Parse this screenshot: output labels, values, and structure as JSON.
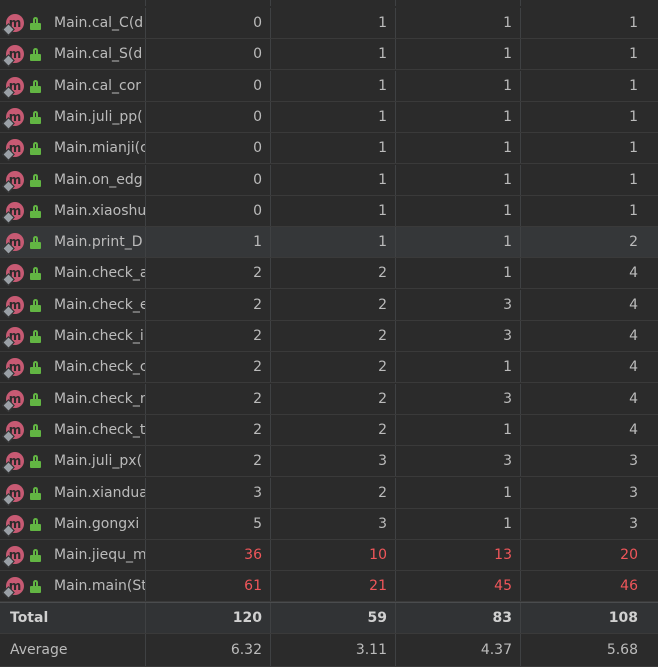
{
  "rows": [
    {
      "name": "Main.cal_C(d",
      "v": [
        "0",
        "1",
        "1",
        "1"
      ],
      "red": [
        false,
        false,
        false,
        false
      ]
    },
    {
      "name": "Main.cal_S(d",
      "v": [
        "0",
        "1",
        "1",
        "1"
      ],
      "red": [
        false,
        false,
        false,
        false
      ]
    },
    {
      "name": "Main.cal_cor",
      "v": [
        "0",
        "1",
        "1",
        "1"
      ],
      "red": [
        false,
        false,
        false,
        false
      ]
    },
    {
      "name": "Main.juli_pp(",
      "v": [
        "0",
        "1",
        "1",
        "1"
      ],
      "red": [
        false,
        false,
        false,
        false
      ]
    },
    {
      "name": "Main.mianji(c",
      "v": [
        "0",
        "1",
        "1",
        "1"
      ],
      "red": [
        false,
        false,
        false,
        false
      ]
    },
    {
      "name": "Main.on_edg",
      "v": [
        "0",
        "1",
        "1",
        "1"
      ],
      "red": [
        false,
        false,
        false,
        false
      ]
    },
    {
      "name": "Main.xiaoshu",
      "v": [
        "0",
        "1",
        "1",
        "1"
      ],
      "red": [
        false,
        false,
        false,
        false
      ]
    },
    {
      "name": "Main.print_D",
      "v": [
        "1",
        "1",
        "1",
        "2"
      ],
      "red": [
        false,
        false,
        false,
        false
      ]
    },
    {
      "name": "Main.check_a",
      "v": [
        "2",
        "2",
        "1",
        "4"
      ],
      "red": [
        false,
        false,
        false,
        false
      ]
    },
    {
      "name": "Main.check_e",
      "v": [
        "2",
        "2",
        "3",
        "4"
      ],
      "red": [
        false,
        false,
        false,
        false
      ]
    },
    {
      "name": "Main.check_i",
      "v": [
        "2",
        "2",
        "3",
        "4"
      ],
      "red": [
        false,
        false,
        false,
        false
      ]
    },
    {
      "name": "Main.check_c",
      "v": [
        "2",
        "2",
        "1",
        "4"
      ],
      "red": [
        false,
        false,
        false,
        false
      ]
    },
    {
      "name": "Main.check_r",
      "v": [
        "2",
        "2",
        "3",
        "4"
      ],
      "red": [
        false,
        false,
        false,
        false
      ]
    },
    {
      "name": "Main.check_t",
      "v": [
        "2",
        "2",
        "1",
        "4"
      ],
      "red": [
        false,
        false,
        false,
        false
      ]
    },
    {
      "name": "Main.juli_px(",
      "v": [
        "2",
        "3",
        "3",
        "3"
      ],
      "red": [
        false,
        false,
        false,
        false
      ]
    },
    {
      "name": "Main.xianduа",
      "v": [
        "3",
        "2",
        "1",
        "3"
      ],
      "red": [
        false,
        false,
        false,
        false
      ]
    },
    {
      "name": "Main.gongxi",
      "v": [
        "5",
        "3",
        "1",
        "3"
      ],
      "red": [
        false,
        false,
        false,
        false
      ]
    },
    {
      "name": "Main.jiequ_m",
      "v": [
        "36",
        "10",
        "13",
        "20"
      ],
      "red": [
        true,
        true,
        true,
        true
      ]
    },
    {
      "name": "Main.main(St",
      "v": [
        "61",
        "21",
        "45",
        "46"
      ],
      "red": [
        true,
        true,
        true,
        true
      ]
    }
  ],
  "selected_row": "Main.print_D",
  "icon": {
    "letter": "m",
    "method_icon": "method-icon",
    "visibility_icon": "public-lock-icon"
  },
  "total": {
    "label": "Total",
    "v": [
      "120",
      "59",
      "83",
      "108"
    ]
  },
  "average": {
    "label": "Average",
    "v": [
      "6.32",
      "3.11",
      "4.37",
      "5.68"
    ]
  },
  "colors": {
    "background": "#2b2b2b",
    "text": "#bbbbbb",
    "red": "#f0565a",
    "method_icon": "#c75a73",
    "lock_icon": "#62b543"
  }
}
